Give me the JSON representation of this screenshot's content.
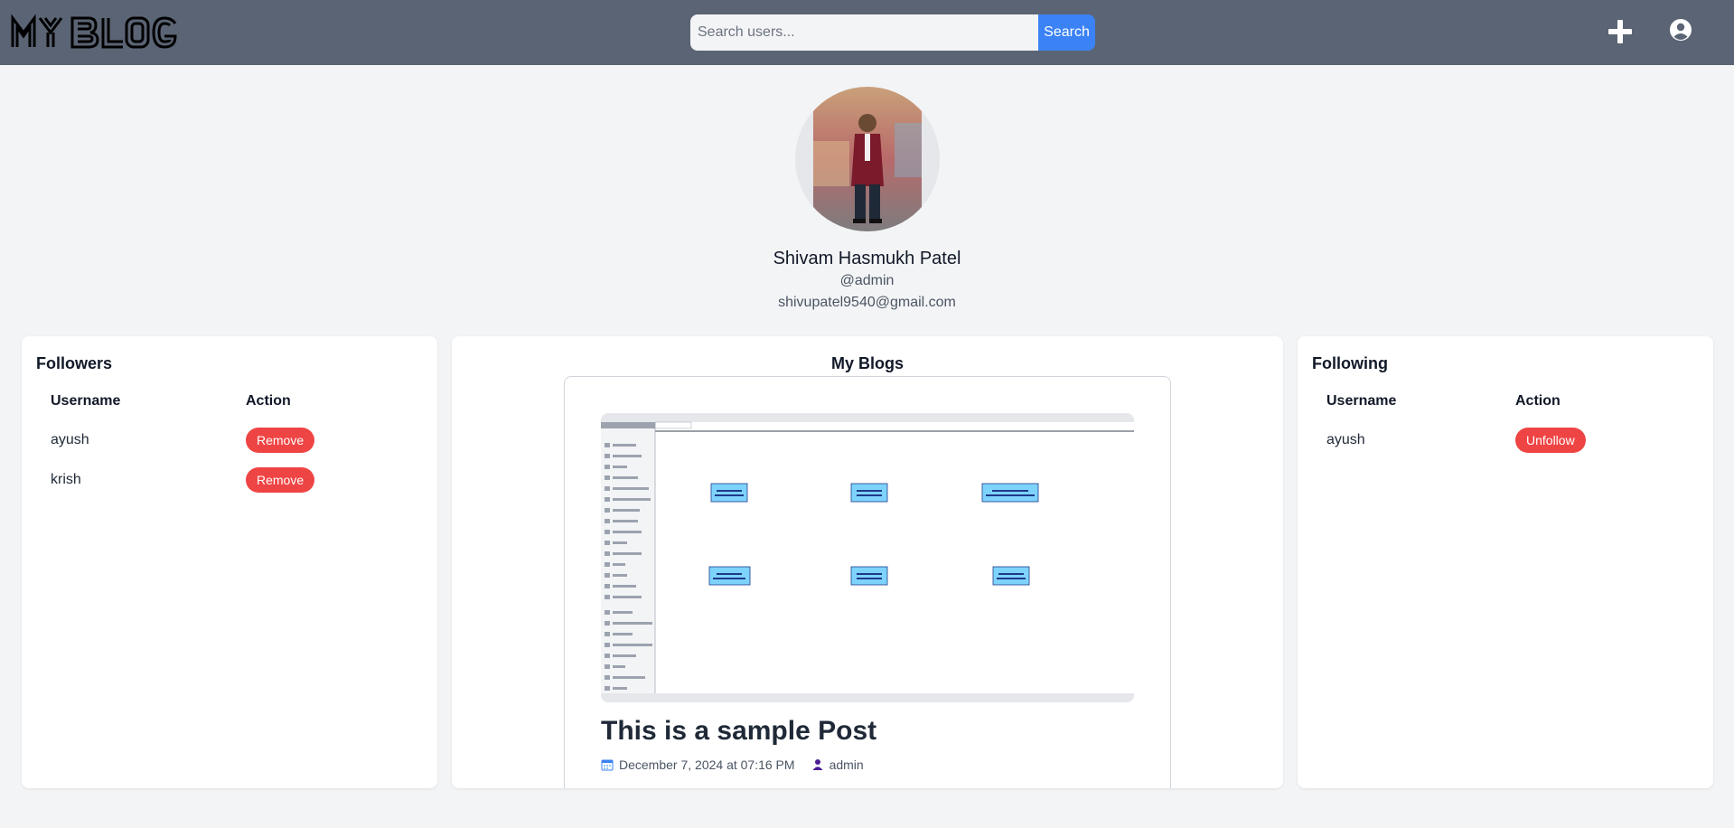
{
  "header": {
    "logo_text": "MY BLOG",
    "search_placeholder": "Search users...",
    "search_button": "Search"
  },
  "profile": {
    "name": "Shivam Hasmukh Patel",
    "handle": "@admin",
    "email": "shivupatel9540@gmail.com"
  },
  "followers": {
    "title": "Followers",
    "col_username": "Username",
    "col_action": "Action",
    "rows": [
      {
        "username": "ayush",
        "action": "Remove"
      },
      {
        "username": "krish",
        "action": "Remove"
      }
    ]
  },
  "blogs": {
    "title": "My Blogs",
    "post": {
      "title": "This is a sample Post",
      "date": "December 7, 2024 at 07:16 PM",
      "author": "admin"
    }
  },
  "following": {
    "title": "Following",
    "col_username": "Username",
    "col_action": "Action",
    "rows": [
      {
        "username": "ayush",
        "action": "Unfollow"
      }
    ]
  },
  "colors": {
    "header_bg": "#5b6474",
    "accent": "#3b82f6",
    "danger": "#ef4444"
  }
}
